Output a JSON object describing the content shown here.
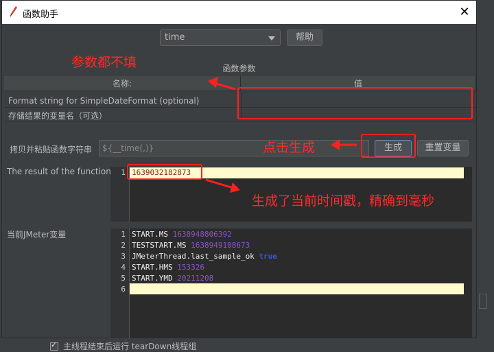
{
  "window": {
    "title": "函数助手",
    "close_glyph": "✕"
  },
  "function_select": {
    "value": "time"
  },
  "help_button": "帮助",
  "params_section_label": "函数参数",
  "params_table": {
    "headers": [
      "名称:",
      "值"
    ],
    "rows": [
      {
        "name": "Format string for SimpleDateFormat (optional)",
        "value": ""
      },
      {
        "name": "存储结果的变量名（可选）",
        "value": ""
      }
    ]
  },
  "copy_label": "拷贝并粘贴函数字符串",
  "function_string": {
    "value": "${__time(,)}"
  },
  "generate_button": "生成",
  "reset_button": "重置变量",
  "result_label": "The result of the function is",
  "result_editor": {
    "lines": [
      {
        "n": "1",
        "text": "1639032182873"
      }
    ]
  },
  "vars_label": "当前JMeter变量",
  "vars_editor": {
    "lines": [
      {
        "n": "1",
        "key": "START.MS ",
        "value": "1638948806392"
      },
      {
        "n": "2",
        "key": "TESTSTART.MS ",
        "value": "1638949108673"
      },
      {
        "n": "3",
        "key": "JMeterThread.last_sample_ok ",
        "value": "true"
      },
      {
        "n": "4",
        "key": "START.HMS ",
        "value": "153326"
      },
      {
        "n": "5",
        "key": "START.YMD ",
        "value": "20211208"
      },
      {
        "n": "6",
        "key": "",
        "value": ""
      }
    ]
  },
  "annotations": {
    "params_empty": "参数都不填",
    "click_generate": "点击生成",
    "generated_timestamp": "生成了当前时间戳，精确到毫秒"
  },
  "background": {
    "checkbox_label": "主线程结束后运行 tearDown线程组"
  },
  "colors": {
    "annotation": "#ff2020",
    "highlight_line": "#fffbcc",
    "value_purple": "#8a54c8"
  }
}
